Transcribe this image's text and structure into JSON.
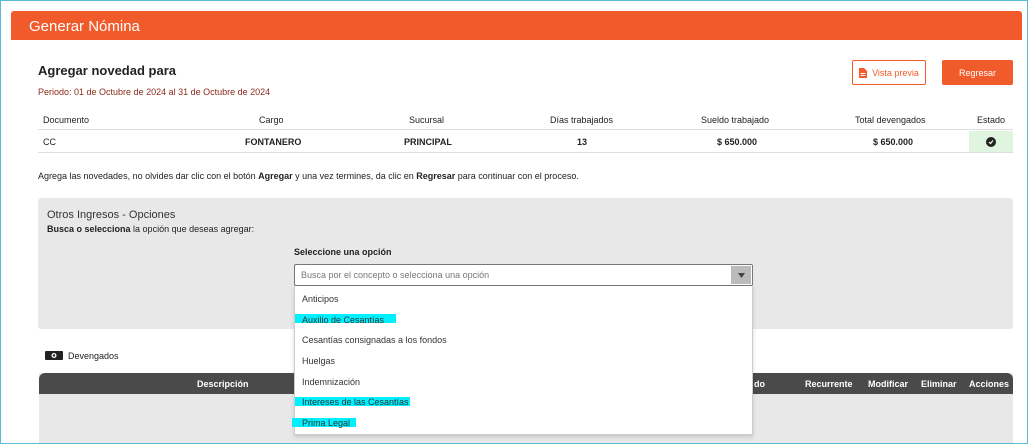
{
  "header": {
    "title": "Generar Nómina"
  },
  "section": {
    "title": "Agregar novedad para",
    "period": "Periodo: 01 de Octubre de 2024 al 31 de Octubre de 2024"
  },
  "buttons": {
    "preview": "Vista previa",
    "back": "Regresar"
  },
  "table": {
    "headers": [
      "Documento",
      "Cargo",
      "Sucursal",
      "Días trabajados",
      "Sueldo trabajado",
      "Total devengados",
      "Estado"
    ],
    "row": {
      "documento": "CC",
      "cargo": "FONTANERO",
      "sucursal": "PRINCIPAL",
      "dias": "13",
      "sueldo": "$ 650.000",
      "total": "$ 650.000"
    }
  },
  "hint": {
    "p1": "Agrega las novedades, no olvides dar clic con el botón ",
    "b1": "Agregar",
    "p2": " y una vez termines, da clic en ",
    "b2": "Regresar",
    "p3": " para continuar con el proceso."
  },
  "panel": {
    "title": "Otros Ingresos - Opciones",
    "sub_bold": "Busca o selecciona",
    "sub_rest": " la opción que deseas agregar:",
    "select_label": "Seleccione una opción",
    "placeholder": "Busca por el concepto o selecciona una opción",
    "options": [
      "Anticipos",
      "Auxilio de Cesantías",
      "Cesantías consignadas a los fondos",
      "Huelgas",
      "Indemnización",
      "Intereses de las Cesantías",
      "Prima Legal"
    ]
  },
  "devengados": {
    "label": "Devengados",
    "headers": [
      "Descripción",
      "do",
      "Recurrente",
      "Modificar",
      "Eliminar",
      "Acciones"
    ]
  },
  "colors": {
    "accent": "#f15a2b",
    "highlight": "#00f0ff",
    "success_bg": "#dff5df"
  }
}
